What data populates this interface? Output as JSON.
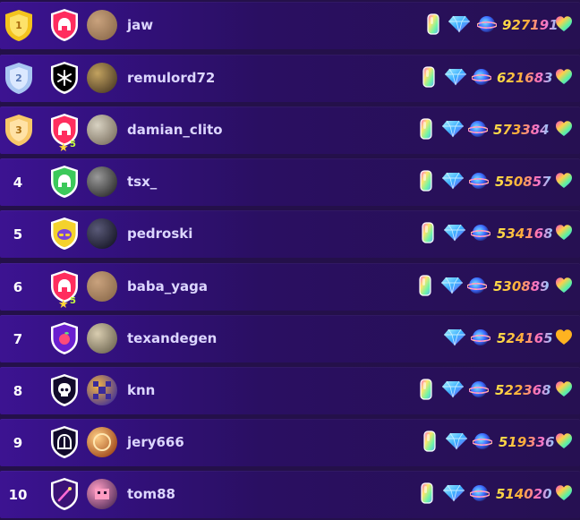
{
  "colors": {
    "gold": "#f3c31d",
    "silver": "#a9c6f2",
    "bronze": "#f7c869",
    "heart_gold": "#ffb320"
  },
  "leaderboard": {
    "rows": [
      {
        "rank": "1",
        "medal": "gold-medal",
        "shield": "spartan-helmet-icon",
        "shield_color": "#ff2d5e",
        "star_level": "",
        "avatar": "cat-avatar",
        "username": "jaw",
        "show_crystal": true,
        "score": "927191",
        "heart": "rainbow-heart-icon"
      },
      {
        "rank": "2",
        "medal": "silver-medal",
        "shield": "snowflake-icon",
        "shield_color": "#000000",
        "star_level": "",
        "avatar": "painting-avatar",
        "username": "remulord72",
        "show_crystal": true,
        "score": "621683",
        "heart": "rainbow-heart-icon"
      },
      {
        "rank": "3",
        "medal": "bronze-medal",
        "shield": "spartan-helmet-icon",
        "shield_color": "#ff2d5e",
        "star_level": "5",
        "avatar": "photo-avatar",
        "username": "damian_clito",
        "show_crystal": true,
        "score": "573384",
        "heart": "rainbow-heart-icon"
      },
      {
        "rank": "4",
        "medal": "",
        "shield": "spartan-helmet-icon",
        "shield_color": "#3cc95a",
        "star_level": "",
        "avatar": "portrait-avatar",
        "username": "tsx_",
        "show_crystal": true,
        "score": "550857",
        "heart": "rainbow-heart-icon"
      },
      {
        "rank": "5",
        "medal": "",
        "shield": "hat-icon",
        "shield_color": "#f4d22c",
        "star_level": "",
        "avatar": "dark-avatar",
        "username": "pedroski",
        "show_crystal": true,
        "score": "534168",
        "heart": "rainbow-heart-icon"
      },
      {
        "rank": "6",
        "medal": "",
        "shield": "spartan-helmet-icon",
        "shield_color": "#ff2d5e",
        "star_level": "5",
        "avatar": "cat-avatar",
        "username": "baba_yaga",
        "show_crystal": true,
        "score": "530889",
        "heart": "rainbow-heart-icon"
      },
      {
        "rank": "7",
        "medal": "",
        "shield": "peach-icon",
        "shield_color": "#6a1fd0",
        "star_level": "",
        "avatar": "sketch-avatar",
        "username": "texandegen",
        "show_crystal": false,
        "score": "524165",
        "heart": "gold-heart-icon"
      },
      {
        "rank": "8",
        "medal": "",
        "shield": "skull-icon",
        "shield_color": "#120a2b",
        "star_level": "",
        "avatar": "pixel-avatar",
        "username": "knn",
        "show_crystal": true,
        "score": "522368",
        "heart": "rainbow-heart-icon"
      },
      {
        "rank": "9",
        "medal": "",
        "shield": "knight-helmet-icon",
        "shield_color": "#120a2b",
        "star_level": "",
        "avatar": "orb-avatar",
        "username": "jery666",
        "show_crystal": true,
        "score": "519336",
        "heart": "rainbow-heart-icon"
      },
      {
        "rank": "10",
        "medal": "",
        "shield": "magic-wand-icon",
        "shield_color": "#3a1276",
        "star_level": "",
        "avatar": "pixel-pig-avatar",
        "username": "tom88",
        "show_crystal": true,
        "score": "514020",
        "heart": "rainbow-heart-icon"
      }
    ]
  }
}
